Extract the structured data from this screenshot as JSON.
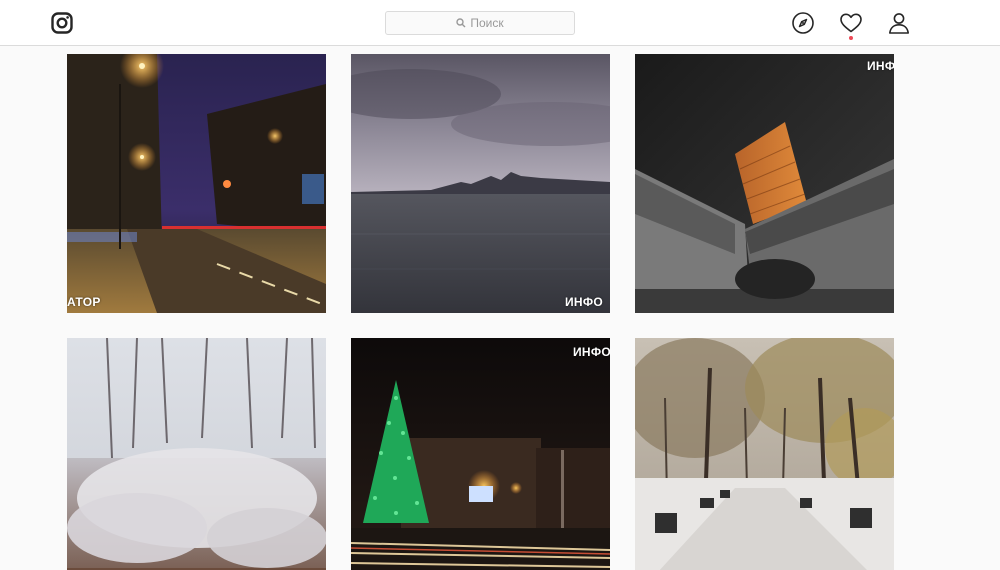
{
  "header": {
    "logo_icon": "instagram-logo-icon",
    "search": {
      "placeholder": "Поиск",
      "icon": "search-icon"
    },
    "nav": [
      {
        "name": "explore",
        "icon": "compass-icon"
      },
      {
        "name": "activity",
        "icon": "heart-icon",
        "has_notification": true
      },
      {
        "name": "profile",
        "icon": "user-icon"
      }
    ],
    "notification_color": "#ed4956"
  },
  "posts": [
    {
      "watermark": "АТОР"
    },
    {
      "watermark": "ИНФО"
    },
    {
      "watermark": "ИНФО"
    },
    {
      "watermark": ""
    },
    {
      "watermark": "ИНФО"
    },
    {
      "watermark": ""
    }
  ],
  "colors": {
    "border": "#dbdbdb",
    "background": "#fafafa",
    "header_bg": "#ffffff"
  }
}
